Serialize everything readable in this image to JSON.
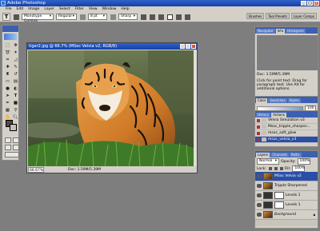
{
  "app": {
    "title": "Adobe Photoshop"
  },
  "menu": [
    "File",
    "Edit",
    "Image",
    "Layer",
    "Select",
    "Filter",
    "View",
    "Window",
    "Help"
  ],
  "options": {
    "tool_glyph": "T",
    "font_family": "Monotype Corsiva",
    "font_style": "Regular",
    "font_size": "8 pt",
    "antialias": "Sharp",
    "panel_tabs": [
      "Brushes",
      "Tool Presets",
      "Layer Comps"
    ]
  },
  "document": {
    "title": "tiger2.jpg @ 66.7% (MSoc Velvia v2, RGB/8)",
    "zoom": "66.67%",
    "doc_info": "Doc: 1.59M/5.39M"
  },
  "navigator": {
    "tabs": [
      "Navigator",
      "Info",
      "Histogram"
    ],
    "doc_info": "Doc: 1.59M/5.39M",
    "hint": "Click for point text. Drag for paragraph text. Use Alt for additional options."
  },
  "color_panel": {
    "tabs": [
      "Color",
      "Swatches",
      "Styles"
    ],
    "value": "100"
  },
  "history": {
    "tabs": [
      "History",
      "Actions"
    ],
    "items": [
      "Velvia Simulation v3",
      "Msoc_tripple_sharpen...",
      "msoc_soft_glow",
      "msoc_velvia_v3"
    ]
  },
  "layers": {
    "tabs": [
      "Layers",
      "Channels",
      "Paths"
    ],
    "blend_mode": "Normal",
    "opacity_label": "Opacity:",
    "opacity": "100%",
    "lock_label": "Lock:",
    "fill_label": "Fill:",
    "fill": "100%",
    "items": [
      "MSoc Velvia v2",
      "Tripple Sharpened",
      "Levels 1",
      "Levels 1",
      "Background"
    ]
  }
}
